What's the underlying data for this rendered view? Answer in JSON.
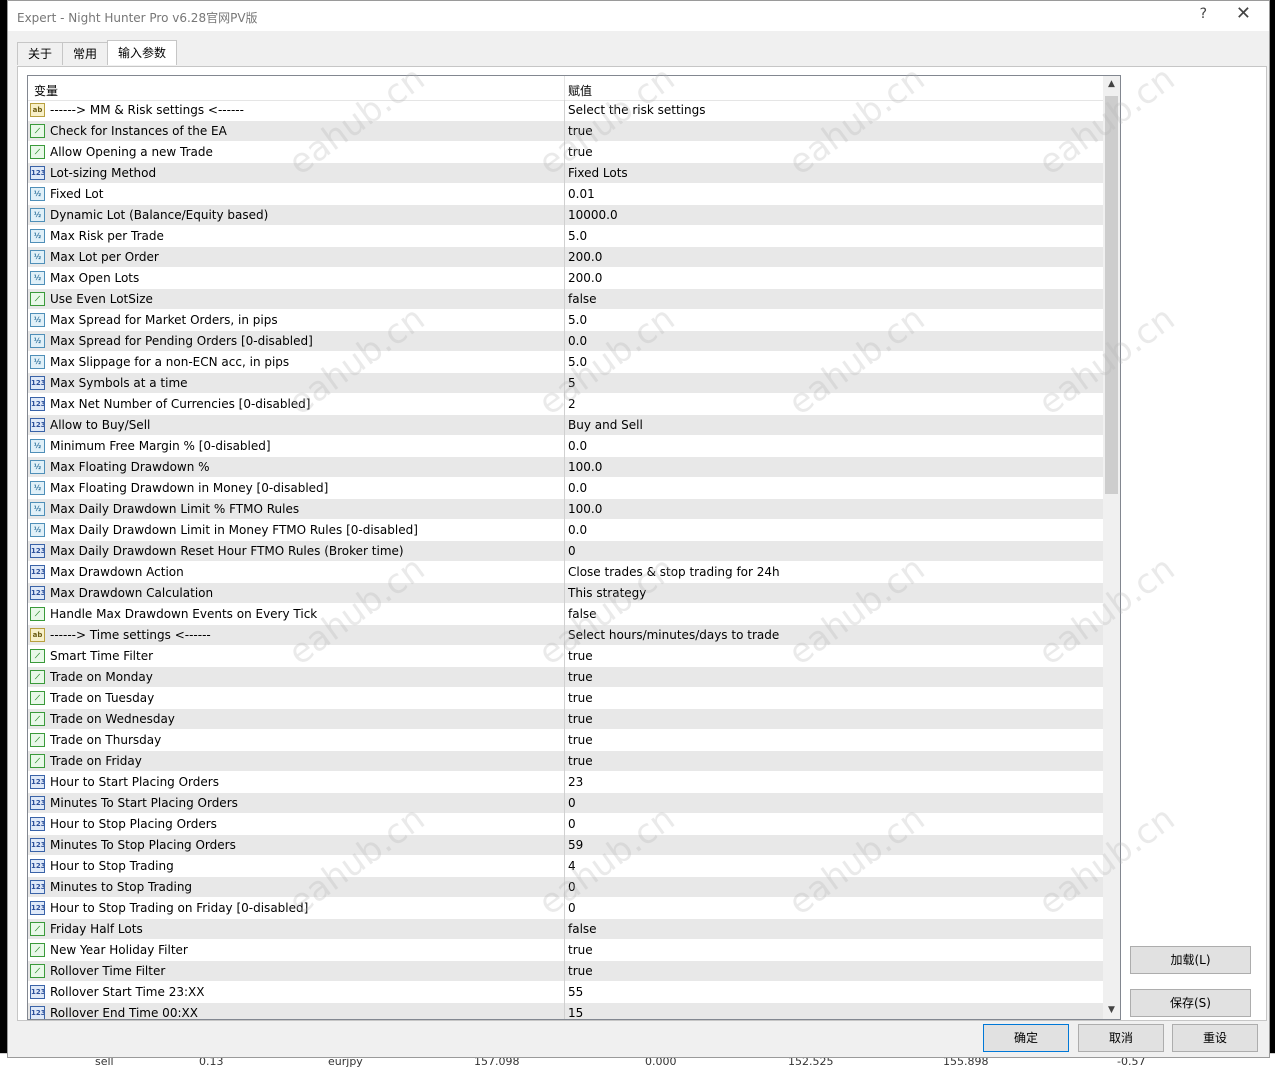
{
  "window": {
    "title": "Expert - Night Hunter Pro v6.28官网PV版",
    "help_glyph": "?",
    "close_glyph": "✕"
  },
  "tabs": [
    {
      "label": "关于",
      "active": false
    },
    {
      "label": "常用",
      "active": false
    },
    {
      "label": "输入参数",
      "active": true
    }
  ],
  "grid": {
    "header": {
      "variable": "变量",
      "value": "赋值"
    },
    "rows": [
      {
        "icon": "string-type-icon",
        "name": "------> MM & Risk settings <------",
        "value": "Select the risk settings"
      },
      {
        "icon": "bool-type-icon",
        "name": "Check for Instances of the EA",
        "value": "true"
      },
      {
        "icon": "bool-type-icon",
        "name": "Allow Opening a new Trade",
        "value": "true"
      },
      {
        "icon": "int-type-icon",
        "name": "Lot-sizing Method",
        "value": "Fixed Lots"
      },
      {
        "icon": "double-type-icon",
        "name": "Fixed Lot",
        "value": "0.01"
      },
      {
        "icon": "double-type-icon",
        "name": "Dynamic Lot (Balance/Equity based)",
        "value": "10000.0"
      },
      {
        "icon": "double-type-icon",
        "name": "Max Risk per Trade",
        "value": "5.0"
      },
      {
        "icon": "double-type-icon",
        "name": "Max Lot per Order",
        "value": "200.0"
      },
      {
        "icon": "double-type-icon",
        "name": "Max Open Lots",
        "value": "200.0"
      },
      {
        "icon": "bool-type-icon",
        "name": "Use Even LotSize",
        "value": "false"
      },
      {
        "icon": "double-type-icon",
        "name": "Max Spread for Market Orders, in pips",
        "value": "5.0"
      },
      {
        "icon": "double-type-icon",
        "name": "Max Spread for Pending Orders [0-disabled]",
        "value": "0.0"
      },
      {
        "icon": "double-type-icon",
        "name": "Max Slippage for a non-ECN acc, in pips",
        "value": "5.0"
      },
      {
        "icon": "int-type-icon",
        "name": "Max Symbols at a time",
        "value": "5"
      },
      {
        "icon": "int-type-icon",
        "name": "Max Net Number of Currencies [0-disabled]",
        "value": "2"
      },
      {
        "icon": "int-type-icon",
        "name": "Allow to Buy/Sell",
        "value": "Buy and Sell"
      },
      {
        "icon": "double-type-icon",
        "name": "Minimum Free Margin % [0-disabled]",
        "value": "0.0"
      },
      {
        "icon": "double-type-icon",
        "name": "Max Floating Drawdown %",
        "value": "100.0"
      },
      {
        "icon": "double-type-icon",
        "name": "Max Floating Drawdown in Money [0-disabled]",
        "value": "0.0"
      },
      {
        "icon": "double-type-icon",
        "name": "Max Daily Drawdown Limit % FTMO Rules",
        "value": "100.0"
      },
      {
        "icon": "double-type-icon",
        "name": "Max Daily Drawdown Limit in Money FTMO Rules [0-disabled]",
        "value": "0.0"
      },
      {
        "icon": "int-type-icon",
        "name": "Max Daily Drawdown Reset Hour FTMO Rules (Broker time)",
        "value": "0"
      },
      {
        "icon": "int-type-icon",
        "name": "Max Drawdown Action",
        "value": "Close trades & stop trading for 24h"
      },
      {
        "icon": "int-type-icon",
        "name": "Max Drawdown Calculation",
        "value": "This strategy"
      },
      {
        "icon": "bool-type-icon",
        "name": "Handle Max Drawdown Events on Every Tick",
        "value": "false"
      },
      {
        "icon": "string-type-icon",
        "name": "------> Time settings <------",
        "value": "Select hours/minutes/days to trade"
      },
      {
        "icon": "bool-type-icon",
        "name": "Smart Time Filter",
        "value": "true"
      },
      {
        "icon": "bool-type-icon",
        "name": "Trade on Monday",
        "value": "true"
      },
      {
        "icon": "bool-type-icon",
        "name": "Trade on Tuesday",
        "value": "true"
      },
      {
        "icon": "bool-type-icon",
        "name": "Trade on Wednesday",
        "value": "true"
      },
      {
        "icon": "bool-type-icon",
        "name": "Trade on Thursday",
        "value": "true"
      },
      {
        "icon": "bool-type-icon",
        "name": "Trade on Friday",
        "value": "true"
      },
      {
        "icon": "int-type-icon",
        "name": "Hour to Start Placing Orders",
        "value": "23"
      },
      {
        "icon": "int-type-icon",
        "name": "Minutes To Start Placing Orders",
        "value": "0"
      },
      {
        "icon": "int-type-icon",
        "name": "Hour to Stop Placing Orders",
        "value": "0"
      },
      {
        "icon": "int-type-icon",
        "name": "Minutes To Stop Placing Orders",
        "value": "59"
      },
      {
        "icon": "int-type-icon",
        "name": "Hour to Stop Trading",
        "value": "4"
      },
      {
        "icon": "int-type-icon",
        "name": "Minutes to Stop Trading",
        "value": "0"
      },
      {
        "icon": "int-type-icon",
        "name": "Hour to Stop Trading on Friday [0-disabled]",
        "value": "0"
      },
      {
        "icon": "bool-type-icon",
        "name": "Friday Half Lots",
        "value": "false"
      },
      {
        "icon": "bool-type-icon",
        "name": "New Year Holiday Filter",
        "value": "true"
      },
      {
        "icon": "bool-type-icon",
        "name": "Rollover Time Filter",
        "value": "true"
      },
      {
        "icon": "int-type-icon",
        "name": "Rollover Start Time 23:XX",
        "value": "55"
      },
      {
        "icon": "int-type-icon",
        "name": "Rollover End Time 00:XX",
        "value": "15"
      }
    ],
    "scroll_up_glyph": "▲",
    "scroll_down_glyph": "▼"
  },
  "icon_glyphs": {
    "bool": "⟋",
    "int": "123",
    "double": "½",
    "string": "ab"
  },
  "buttons": {
    "load": "加载(L)",
    "save": "保存(S)",
    "ok": "确定",
    "cancel": "取消",
    "reset": "重设"
  },
  "watermark_text": "eahub.cn",
  "background_strip": [
    "sell",
    "0.13",
    "eurjpy",
    "157.098",
    "0.000",
    "152.525",
    "155.898",
    "-0.57"
  ]
}
